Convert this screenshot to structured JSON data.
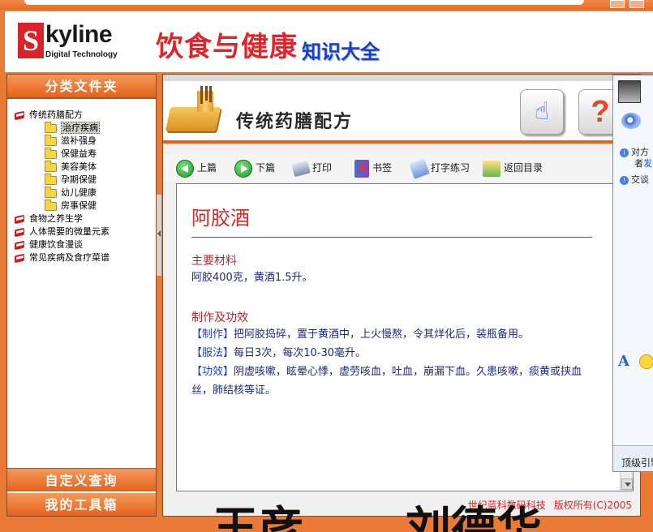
{
  "app": {
    "logo_letter": "S",
    "logo_word": "kyline",
    "logo_sub": "Digital Technology",
    "title": "饮食与健康",
    "subtitle": "知识大全"
  },
  "sidebar": {
    "header": "分类文件夹",
    "tree": [
      {
        "label": "传统药膳配方",
        "level": 0,
        "icon": "book-icon"
      },
      {
        "label": "治疗疾病",
        "level": 1,
        "icon": "folder-open-icon",
        "selected": true
      },
      {
        "label": "滋补强身",
        "level": 1,
        "icon": "folder-icon"
      },
      {
        "label": "保健益寿",
        "level": 1,
        "icon": "folder-icon"
      },
      {
        "label": "美容美体",
        "level": 1,
        "icon": "folder-icon"
      },
      {
        "label": "孕期保健",
        "level": 1,
        "icon": "folder-icon"
      },
      {
        "label": "幼儿健康",
        "level": 1,
        "icon": "folder-icon"
      },
      {
        "label": "房事保健",
        "level": 1,
        "icon": "folder-icon"
      },
      {
        "label": "食物之养生学",
        "level": 0,
        "icon": "book-icon"
      },
      {
        "label": "人体需要的微量元素",
        "level": 0,
        "icon": "book-icon"
      },
      {
        "label": "健康饮食漫谈",
        "level": 0,
        "icon": "book-icon"
      },
      {
        "label": "常见疾病及食疗菜谱",
        "level": 0,
        "icon": "book-icon"
      }
    ],
    "footer1": "自定义查询",
    "footer2": "我的工具箱"
  },
  "main": {
    "page_title": "传统药膳配方",
    "toolbar": {
      "prev": "上篇",
      "next": "下篇",
      "print": "打印",
      "bookmark": "书签",
      "typing": "打字练习",
      "back": "返回目录"
    },
    "article": {
      "title": "阿胶酒",
      "section1_heading": "主要材料",
      "section1_text": "阿胶400克，黄酒1.5升。",
      "section2_heading": "制作及功效",
      "lines": [
        {
          "tag": "【制作】",
          "text": "把阿胶捣碎，置于黄酒中，上火慢熬，令其烊化后，装瓶备用。"
        },
        {
          "tag": "【服法】",
          "text": "每日3次，每次10-30毫升。"
        },
        {
          "tag": "【功效】",
          "text": "阴虚咳嗽，眩晕心悸，虚劳咳血，吐血，崩漏下血。久患咳嗽，痰黄或挟血丝，肺结核等证。"
        }
      ]
    },
    "copyright_company": "世纪蓝科数码科技",
    "copyright_rights": "版权所有(C)2005"
  },
  "bottom_text": {
    "left": "王彦",
    "right": "刘德华"
  },
  "messenger": {
    "line1": "对方",
    "line2_prefix": "者",
    "line2_link": "发",
    "line3": "交谈",
    "bottom": "顶级引擎"
  },
  "colors": {
    "accent_orange": "#e4631d",
    "title_red": "#e0262b",
    "subtitle_blue": "#1a3fbf",
    "text_blue": "#1c2a7a"
  }
}
